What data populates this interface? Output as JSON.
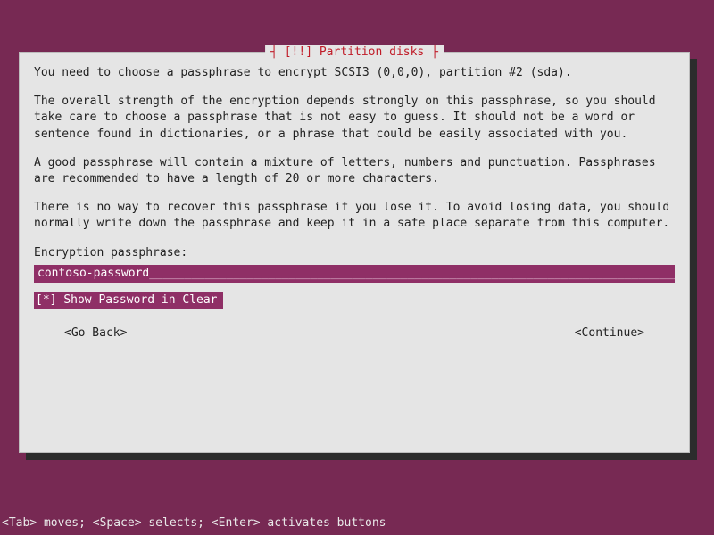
{
  "dialog": {
    "title": "[!!] Partition disks",
    "paragraphs": [
      "You need to choose a passphrase to encrypt SCSI3 (0,0,0), partition #2 (sda).",
      "The overall strength of the encryption depends strongly on this passphrase, so you should take care to choose a passphrase that is not easy to guess. It should not be a word or sentence found in dictionaries, or a phrase that could be easily associated with you.",
      "A good passphrase will contain a mixture of letters, numbers and punctuation. Passphrases are recommended to have a length of 20 or more characters.",
      "There is no way to recover this passphrase if you lose it. To avoid losing data, you should normally write down the passphrase and keep it in a safe place separate from this computer."
    ],
    "field_label": "Encryption passphrase:",
    "passphrase_value": "contoso-password",
    "show_password": {
      "checked_glyph": "[*]",
      "label": "Show Password in Clear"
    },
    "buttons": {
      "back": "<Go Back>",
      "continue": "<Continue>"
    }
  },
  "helpbar": "<Tab> moves; <Space> selects; <Enter> activates buttons"
}
